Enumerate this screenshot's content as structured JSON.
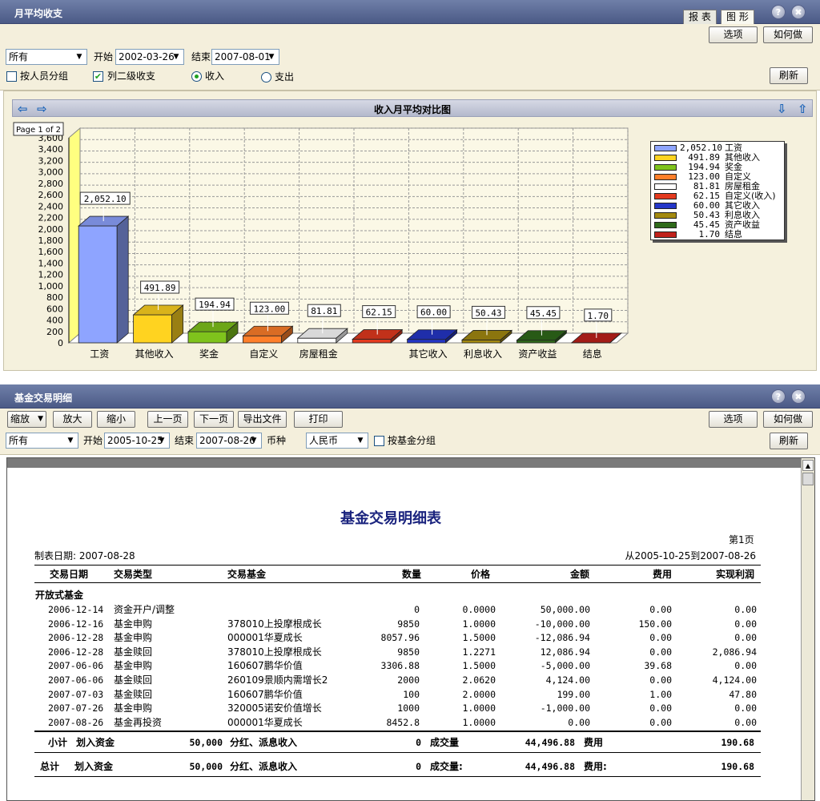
{
  "top_panel": {
    "title": "月平均收支",
    "tabs": [
      "报 表",
      "图 形"
    ],
    "help": "?",
    "close": "✖",
    "options_button": "选项",
    "howto_button": "如何做",
    "filter": {
      "scope": "所有",
      "start_label": "开始",
      "start_date": "2002-03-26",
      "end_label": "结束",
      "end_date": "2007-08-01",
      "group_by_person": "按人员分组",
      "list_secondary": "列二级收支",
      "list_secondary_checked": true,
      "income_label": "收入",
      "expense_label": "支出",
      "selected": "income",
      "refresh_button": "刷新"
    }
  },
  "chart_header": {
    "title": "收入月平均对比图",
    "page_label": "Page 1 of 2"
  },
  "chart_data": {
    "type": "bar",
    "categories": [
      "工资",
      "其他收入",
      "奖金",
      "自定义",
      "房屋租金",
      "自定义(收入)",
      "其它收入",
      "利息收入",
      "资产收益",
      "结息"
    ],
    "x_tick_labels": [
      "工资",
      "其他收入",
      "奖金",
      "自定义",
      "房屋租金",
      "",
      "其它收入",
      "利息收入",
      "资产收益",
      "结息"
    ],
    "values": [
      2052.1,
      491.89,
      194.94,
      123.0,
      81.81,
      62.15,
      60.0,
      50.43,
      45.45,
      1.7
    ],
    "value_labels": [
      "2,052.10",
      "491.89",
      "194.94",
      "123.00",
      "81.81",
      "62.15",
      "60.00",
      "50.43",
      "45.45",
      "1.70"
    ],
    "colors": [
      "#8ea4ff",
      "#ffd320",
      "#7fc31c",
      "#ff7f2a",
      "#ffffff",
      "#e33a1f",
      "#2436c8",
      "#a48a10",
      "#2f6a1a",
      "#c0211b"
    ],
    "ylim": [
      0,
      3600
    ],
    "yticks": [
      "0",
      "200",
      "400",
      "600",
      "800",
      "1,000",
      "1,200",
      "1,400",
      "1,600",
      "1,800",
      "2,000",
      "2,200",
      "2,400",
      "2,600",
      "2,800",
      "3,000",
      "3,200",
      "3,400",
      "3,600"
    ],
    "grid": true,
    "legend_position": "right",
    "legend": [
      {
        "value": "2,052.10",
        "name": "工资"
      },
      {
        "value": "491.89",
        "name": "其他收入"
      },
      {
        "value": "194.94",
        "name": "奖金"
      },
      {
        "value": "123.00",
        "name": "自定义"
      },
      {
        "value": "81.81",
        "name": "房屋租金"
      },
      {
        "value": "62.15",
        "name": "自定义(收入)"
      },
      {
        "value": "60.00",
        "name": "其它收入"
      },
      {
        "value": "50.43",
        "name": "利息收入"
      },
      {
        "value": "45.45",
        "name": "资产收益"
      },
      {
        "value": "1.70",
        "name": "结息"
      }
    ]
  },
  "bottom_panel": {
    "title": "基金交易明细",
    "help": "?",
    "close": "✖",
    "toolbar": {
      "zoom": "缩放",
      "zoom_in": "放大",
      "zoom_out": "缩小",
      "prev_page": "上一页",
      "next_page": "下一页",
      "export": "导出文件",
      "print": "打印",
      "options": "选项",
      "howto": "如何做"
    },
    "filter": {
      "scope": "所有",
      "start_label": "开始",
      "start_date": "2005-10-25",
      "end_label": "结束",
      "end_date": "2007-08-26",
      "currency_label": "币种",
      "currency": "人民币",
      "group_by_fund": "按基金分组",
      "refresh_button": "刷新"
    }
  },
  "report": {
    "title": "基金交易明细表",
    "page": "第1页",
    "made_date": "制表日期: 2007-08-28",
    "range": "从2005-10-25到2007-08-26",
    "columns": [
      "交易日期",
      "交易类型",
      "交易基金",
      "数量",
      "价格",
      "金额",
      "费用",
      "实现利润"
    ],
    "section": "开放式基金",
    "rows": [
      [
        "2006-12-14",
        "资金开户/调整",
        "",
        "0",
        "0.0000",
        "50,000.00",
        "0.00",
        "0.00"
      ],
      [
        "2006-12-16",
        "基金申购",
        "378010上投摩根成长",
        "9850",
        "1.0000",
        "-10,000.00",
        "150.00",
        "0.00"
      ],
      [
        "2006-12-28",
        "基金申购",
        "000001华夏成长",
        "8057.96",
        "1.5000",
        "-12,086.94",
        "0.00",
        "0.00"
      ],
      [
        "2006-12-28",
        "基金赎回",
        "378010上投摩根成长",
        "9850",
        "1.2271",
        "12,086.94",
        "0.00",
        "2,086.94"
      ],
      [
        "2007-06-06",
        "基金申购",
        "160607鹏华价值",
        "3306.88",
        "1.5000",
        "-5,000.00",
        "39.68",
        "0.00"
      ],
      [
        "2007-06-06",
        "基金赎回",
        "260109景顺内需增长2",
        "2000",
        "2.0620",
        "4,124.00",
        "0.00",
        "4,124.00"
      ],
      [
        "2007-07-03",
        "基金赎回",
        "160607鹏华价值",
        "100",
        "2.0000",
        "199.00",
        "1.00",
        "47.80"
      ],
      [
        "2007-07-26",
        "基金申购",
        "320005诺安价值增长",
        "1000",
        "1.0000",
        "-1,000.00",
        "0.00",
        "0.00"
      ],
      [
        "2007-08-26",
        "基金再投资",
        "000001华夏成长",
        "8452.8",
        "1.0000",
        "0.00",
        "0.00",
        "0.00"
      ]
    ],
    "subtotal": {
      "label": "小计",
      "in_label": "划入资金",
      "in_value": "50,000",
      "div_label": "分红、派息收入",
      "div_value": "0",
      "vol_label": "成交量",
      "vol_value": "44,496.88",
      "fee_label": "费用",
      "fee_value": "190.68"
    },
    "total": {
      "label": "总计",
      "in_label": "划入资金",
      "in_value": "50,000",
      "div_label": "分红、派息收入",
      "div_value": "0",
      "vol_label": "成交量:",
      "vol_value": "44,496.88",
      "fee_label": "费用:",
      "fee_value": "190.68"
    }
  }
}
